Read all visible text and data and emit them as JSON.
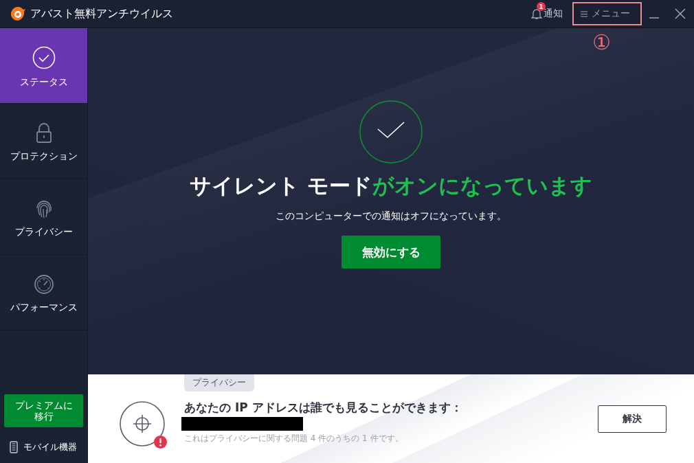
{
  "window": {
    "title": "アバスト無料アンチウイルス",
    "notifications": {
      "label": "通知",
      "badge": "1"
    },
    "menu": {
      "label": "メニュー",
      "highlighted": true
    },
    "annotation": "①"
  },
  "sidebar": {
    "items": [
      {
        "label": "ステータス",
        "selected": true
      },
      {
        "label": "プロテクション",
        "selected": false
      },
      {
        "label": "プライバシー",
        "selected": false
      },
      {
        "label": "パフォーマンス",
        "selected": false
      }
    ],
    "premium_button": "プレミアムに移行",
    "mobile_link": "モバイル機器"
  },
  "status": {
    "headline_lead": "サイレント モード",
    "headline_status": "がオンになっています",
    "message": "このコンピューターでの通知はオフになっています。",
    "button": "無効にする"
  },
  "alert": {
    "tag": "プライバシー",
    "title": "あなたの IP アドレスは誰でも見ることができます：",
    "note": "これはプライバシーに関する問題 4 件のうちの 1 件です。",
    "button": "解決"
  }
}
